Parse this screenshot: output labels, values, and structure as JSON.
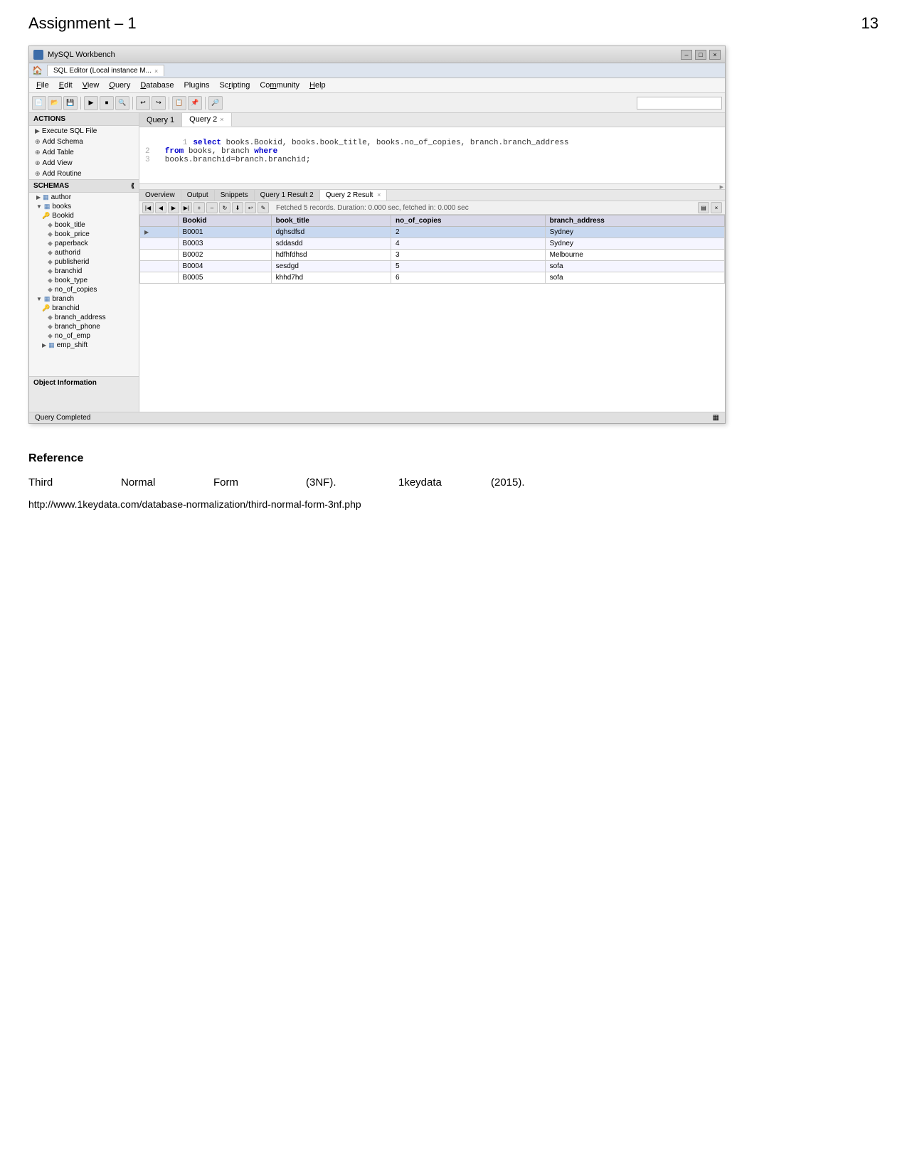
{
  "page": {
    "title": "Assignment – 1",
    "page_number": "13"
  },
  "workbench": {
    "title": "MySQL Workbench",
    "tab_title": "SQL Editor (Local instance M...",
    "menubar": [
      "File",
      "Edit",
      "View",
      "Query",
      "Database",
      "Plugins",
      "Scripting",
      "Community",
      "Help"
    ],
    "tabs": [
      {
        "label": "Query 1",
        "active": false
      },
      {
        "label": "Query 2",
        "active": true
      }
    ],
    "query_lines": [
      {
        "num": "1",
        "text": "select books.Bookid, books.book_title, books.no_of_copies, branch.branch_address"
      },
      {
        "num": "2",
        "text": "  from books, branch where"
      },
      {
        "num": "3",
        "text": "  books.branchid=branch.branchid;"
      }
    ],
    "result_tabs": [
      {
        "label": "Overview"
      },
      {
        "label": "Output"
      },
      {
        "label": "Snippets"
      },
      {
        "label": "Query 1 Result 2"
      },
      {
        "label": "Query 2 Result",
        "active": true
      }
    ],
    "result_status": "Fetched 5 records. Duration: 0.000 sec, fetched in: 0.000 sec",
    "result_columns": [
      "Bookid",
      "book_title",
      "no_of_copies",
      "branch_address"
    ],
    "result_rows": [
      {
        "selected": true,
        "bookid": "B0001",
        "book_title": "dghsdfsd",
        "no_of_copies": "2",
        "branch_address": "Sydney"
      },
      {
        "selected": false,
        "bookid": "B0003",
        "book_title": "sddasdd",
        "no_of_copies": "4",
        "branch_address": "Sydney"
      },
      {
        "selected": false,
        "bookid": "B0002",
        "book_title": "hdfhfdhsd",
        "no_of_copies": "3",
        "branch_address": "Melbourne"
      },
      {
        "selected": false,
        "bookid": "B0004",
        "book_title": "sesdgd",
        "no_of_copies": "5",
        "branch_address": "sofa"
      },
      {
        "selected": false,
        "bookid": "B0005",
        "book_title": "khhd7hd",
        "no_of_copies": "6",
        "branch_address": "sofa"
      }
    ],
    "actions": [
      {
        "label": "Execute SQL File",
        "icon": "▶"
      },
      {
        "label": "Add Schema",
        "icon": "⊕"
      },
      {
        "label": "Add Table",
        "icon": "⊕"
      },
      {
        "label": "Add View",
        "icon": "⊕"
      },
      {
        "label": "Add Routine",
        "icon": "⊕"
      }
    ],
    "schemas_title": "SCHEMAS",
    "tree": [
      {
        "level": 1,
        "type": "expand",
        "label": "author"
      },
      {
        "level": 1,
        "type": "expand",
        "label": "books"
      },
      {
        "level": 2,
        "type": "key",
        "label": "Bookid"
      },
      {
        "level": 3,
        "type": "col",
        "label": "book_title"
      },
      {
        "level": 3,
        "type": "col",
        "label": "book_price"
      },
      {
        "level": 3,
        "type": "col",
        "label": "paperback"
      },
      {
        "level": 3,
        "type": "col",
        "label": "authorid"
      },
      {
        "level": 3,
        "type": "col",
        "label": "publisherid"
      },
      {
        "level": 3,
        "type": "col",
        "label": "branchid"
      },
      {
        "level": 3,
        "type": "col",
        "label": "book_type"
      },
      {
        "level": 3,
        "type": "col",
        "label": "no_of_copies"
      },
      {
        "level": 2,
        "type": "expand",
        "label": "branch"
      },
      {
        "level": 3,
        "type": "key",
        "label": "branchid"
      },
      {
        "level": 4,
        "type": "col",
        "label": "branch_address"
      },
      {
        "level": 4,
        "type": "col",
        "label": "branch_phone"
      },
      {
        "level": 4,
        "type": "col",
        "label": "no_of_emp"
      },
      {
        "level": 2,
        "type": "col",
        "label": "emp_shift"
      }
    ],
    "status_bar": "Query Completed"
  },
  "reference": {
    "heading": "Reference",
    "citation_words": [
      "Third",
      "Normal",
      "Form",
      "(3NF).",
      "1keydata",
      "(2015)."
    ],
    "url": "http://www.1keydata.com/database-normalization/third-normal-form-3nf.php"
  }
}
